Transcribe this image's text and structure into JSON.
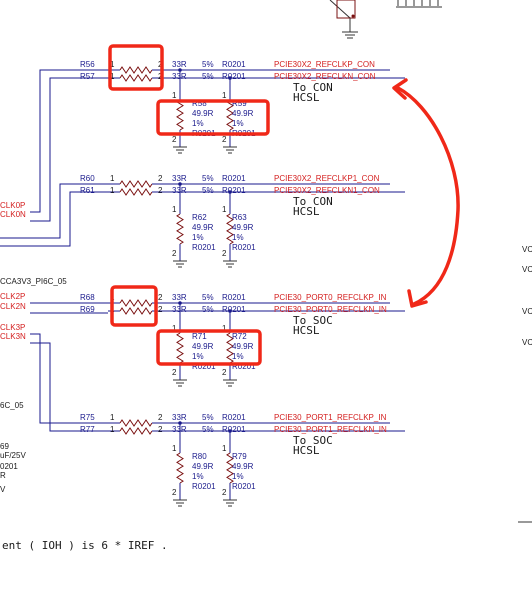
{
  "left_edge": {
    "labels": [
      "CLK0P",
      "CLK0N",
      "CCA3V3_PI6C_05",
      "CLK2P",
      "CLK2N",
      "CLK3P",
      "CLK3N",
      "6C_05",
      "69",
      "uF/25V",
      "R",
      "V",
      "0201"
    ]
  },
  "right_edge": {
    "labels": [
      "VC",
      "VC",
      "VC",
      "VC"
    ]
  },
  "blocks": [
    {
      "r_top": "R56",
      "r_bot": "R57",
      "pin1": "1",
      "pin2": "2",
      "val_top": "33R",
      "val_bot": "33R",
      "tol_top": "5%",
      "tol_bot": "5%",
      "pkg_top": "R0201",
      "pkg_bot": "R0201",
      "net_p": "PCIE30X2_REFCLKP_CON",
      "net_n": "PCIE30X2_REFCLKN_CON",
      "dest": "To CON",
      "std": "HCSL",
      "pd_a": {
        "ref": "R58",
        "val": "49.9R",
        "tol": "1%",
        "pkg": "R0201"
      },
      "pd_b": {
        "ref": "R59",
        "val": "49.9R",
        "tol": "1%",
        "pkg": "R0201"
      }
    },
    {
      "r_top": "R60",
      "r_bot": "R61",
      "pin1": "1",
      "pin2": "2",
      "val_top": "33R",
      "val_bot": "33R",
      "tol_top": "5%",
      "tol_bot": "5%",
      "pkg_top": "R0201",
      "pkg_bot": "R0201",
      "net_p": "PCIE30X2_REFCLKP1_CON",
      "net_n": "PCIE30X2_REFCLKN1_CON",
      "dest": "To CON",
      "std": "HCSL",
      "pd_a": {
        "ref": "R62",
        "val": "49.9R",
        "tol": "1%",
        "pkg": "R0201"
      },
      "pd_b": {
        "ref": "R63",
        "val": "49.9R",
        "tol": "1%",
        "pkg": "R0201"
      }
    },
    {
      "r_top": "R68",
      "r_bot": "R69",
      "pin1": "1",
      "pin2": "2",
      "val_top": "33R",
      "val_bot": "33R",
      "tol_top": "5%",
      "tol_bot": "5%",
      "pkg_top": "R0201",
      "pkg_bot": "R0201",
      "net_p": "PCIE30_PORT0_REFCLKP_IN",
      "net_n": "PCIE30_PORT0_REFCLKN_IN",
      "dest": "To SOC",
      "std": "HCSL",
      "pd_a": {
        "ref": "R71",
        "val": "49.9R",
        "tol": "1%",
        "pkg": "R0201"
      },
      "pd_b": {
        "ref": "R72",
        "val": "49.9R",
        "tol": "1%",
        "pkg": "R0201"
      }
    },
    {
      "r_top": "R75",
      "r_bot": "R77",
      "pin1": "1",
      "pin2": "2",
      "val_top": "33R",
      "val_bot": "33R",
      "tol_top": "5%",
      "tol_bot": "5%",
      "pkg_top": "R0201",
      "pkg_bot": "R0201",
      "net_p": "PCIE30_PORT1_REFCLKP_IN",
      "net_n": "PCIE30_PORT1_REFCLKN_IN",
      "dest": "To SOC",
      "std": "HCSL",
      "pd_a": {
        "ref": "R80",
        "val": "49.9R",
        "tol": "1%",
        "pkg": "R0201"
      },
      "pd_b": {
        "ref": "R79",
        "val": "49.9R",
        "tol": "1%",
        "pkg": "R0201"
      }
    }
  ],
  "footer_note": "ent ( IOH ) is 6 * IREF .",
  "colors": {
    "wire": "#1a1a8c",
    "part": "#7a1010",
    "net": "#d42020",
    "text": "#1a1a1a",
    "markup": "#f02818"
  }
}
